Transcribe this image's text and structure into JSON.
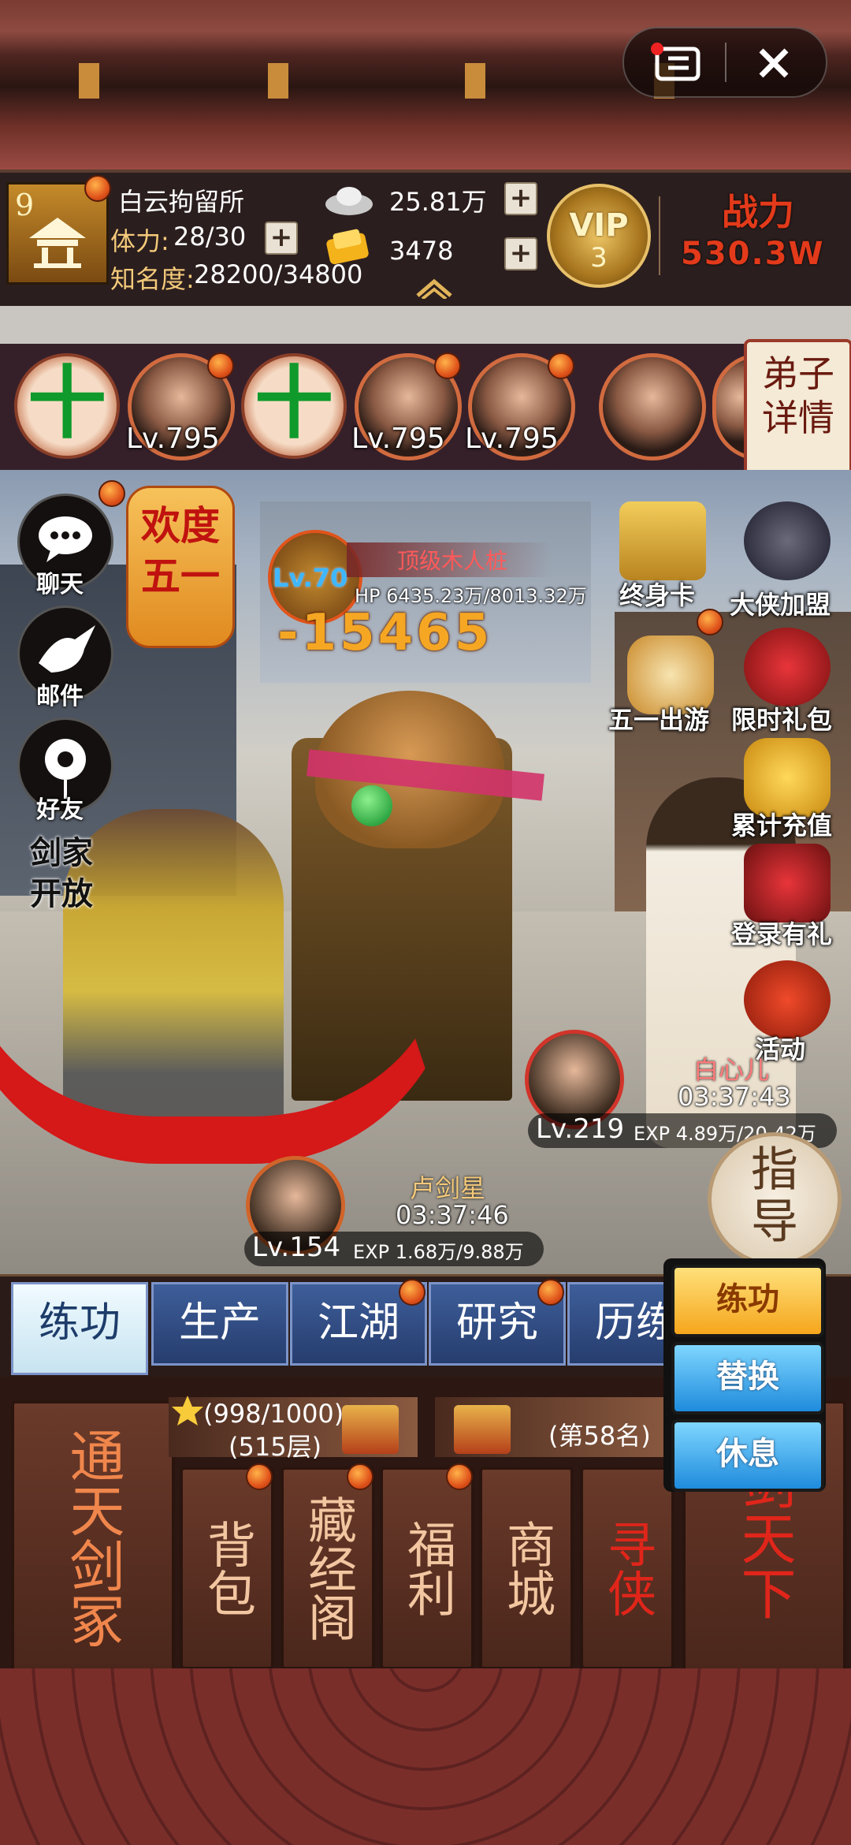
{
  "header": {
    "location_name": "白云拘留所",
    "location_level": "9",
    "stamina_label": "体力:",
    "stamina_value": "28/30",
    "fame_label": "知名度:",
    "fame_value": "28200/34800",
    "silver_value": "25.81万",
    "gold_value": "3478",
    "vip_label": "VIP",
    "vip_level": "3",
    "power_label": "战力",
    "power_value": "530.3W"
  },
  "heroes": {
    "slots": [
      {
        "type": "add",
        "glyph": "十"
      },
      {
        "type": "hero",
        "level": "Lv.795"
      },
      {
        "type": "add",
        "glyph": "十"
      },
      {
        "type": "hero",
        "level": "Lv.795"
      },
      {
        "type": "hero",
        "level": "Lv.795"
      },
      {
        "type": "hero",
        "level": ""
      }
    ],
    "details_label": "弟子详情"
  },
  "left_menu": {
    "festival_banner": "欢度五一",
    "chat": "聊天",
    "mail": "邮件",
    "friends": "好友",
    "sword_clan": "剑家开放"
  },
  "right_menu": [
    {
      "label": "终身卡"
    },
    {
      "label": "大侠加盟"
    },
    {
      "label": "五一出游"
    },
    {
      "label": "限时礼包"
    },
    {
      "label": "累计充值"
    },
    {
      "label": "登录有礼"
    },
    {
      "label": "活动"
    }
  ],
  "battle": {
    "boss_name": "顶级木人桩",
    "boss_level": "Lv.70",
    "boss_hp": "HP 6435.23万/8013.32万",
    "damage": "-15465",
    "fighter_name": "卢剑星",
    "fighter_timer": "03:37:46",
    "fighter_level": "Lv.154",
    "fighter_exp": "EXP 1.68万/9.88万",
    "npc_name": "白心儿",
    "npc_timer": "03:37:43",
    "npc_level": "Lv.219",
    "npc_exp": "EXP 4.89万/20.42万",
    "guide_label": "指导"
  },
  "tabs": [
    "练功",
    "生产",
    "江湖",
    "研究",
    "历练"
  ],
  "actions": {
    "train": "练功",
    "replace": "替换",
    "rest": "休息"
  },
  "bottom": {
    "tower_label": "通天剑冢",
    "tower_progress": "(998/1000)",
    "tower_floor": "(515层)",
    "rank": "(第58名)",
    "bag": "背包",
    "library": "藏经阁",
    "welfare": "福利",
    "shop": "商城",
    "seek": "寻侠",
    "world": "剑天下"
  },
  "colors": {
    "add_plus": "#0f9a2b",
    "notify_dot": "#e0541b",
    "power_red": "#e23a1a",
    "tab_blue": "#2f4f8a",
    "action_gold": "#f5b51c",
    "action_blue": "#1e9be0"
  }
}
